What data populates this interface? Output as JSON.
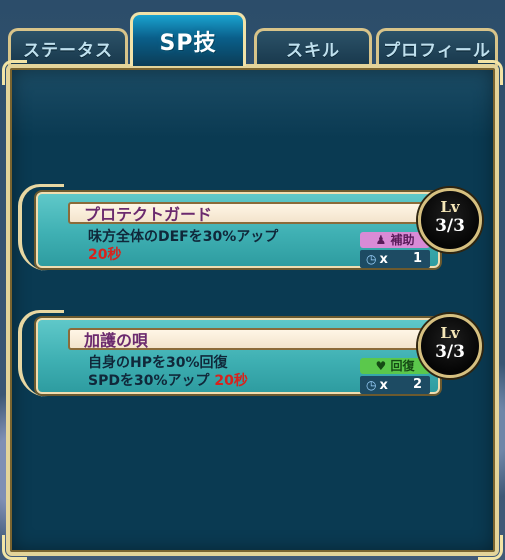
{
  "tabs": [
    {
      "label": "ステータス",
      "active": false
    },
    {
      "label": "SP技",
      "active": true
    },
    {
      "label": "スキル",
      "active": false
    },
    {
      "label": "プロフィール",
      "active": false
    }
  ],
  "skills": [
    {
      "name": "プロテクトガード",
      "desc_line1": "味方全体のDEFを30%アップ",
      "desc_line2_text": "",
      "desc_line2_red": "20秒",
      "badge": "補助",
      "count_prefix": "x",
      "count": "1",
      "lv_label": "Lv",
      "lv_value": "3/3"
    },
    {
      "name": "加護の唄",
      "desc_line1": "自身のHPを30%回復",
      "desc_line2_text": "SPDを30%アップ ",
      "desc_line2_red": "20秒",
      "badge": "回復",
      "count_prefix": "x",
      "count": "2",
      "lv_label": "Lv",
      "lv_value": "3/3"
    }
  ],
  "icons": {
    "support_badge_icon": "flask-icon",
    "heal_badge_icon": "heart-icon",
    "count_icon": "gauge-icon"
  }
}
